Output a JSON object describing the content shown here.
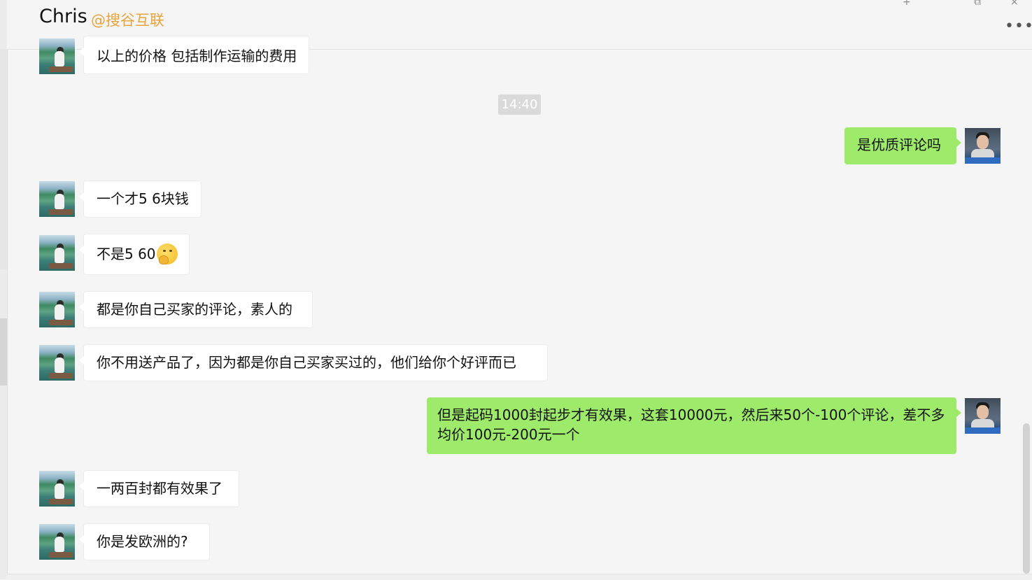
{
  "header": {
    "title": "Chris",
    "subtitle": "@搜谷互联",
    "pin_glyph": "+",
    "restore_glyph": "⧉",
    "close_glyph": "×",
    "more_glyph": "•••"
  },
  "time_separator": "14:40",
  "messages": [
    {
      "side": "left",
      "text": "以上的价格 包括制作运输的费用"
    },
    {
      "side": "right",
      "text": "是优质评论吗"
    },
    {
      "side": "left",
      "text": "一个才5 6块钱"
    },
    {
      "side": "left",
      "text": "不是5 60",
      "emoji": "thinking-face"
    },
    {
      "side": "left",
      "text": "都是你自己买家的评论，素人的"
    },
    {
      "side": "left",
      "text": "你不用送产品了，因为都是你自己买家买过的，他们给你个好评而已"
    },
    {
      "side": "right",
      "text": "但是起码1000封起步才有效果，这套10000元，然后来50个-100个评论，差不多均价100元-200元一个"
    },
    {
      "side": "left",
      "text": "一两百封都有效果了"
    },
    {
      "side": "left",
      "text": "你是发欧洲的?"
    }
  ],
  "colors": {
    "background": "#f5f5f5",
    "incoming_bubble": "#ffffff",
    "outgoing_bubble": "#9eea6a",
    "subtitle_accent": "#e8a33a",
    "time_chip": "#dadada"
  }
}
